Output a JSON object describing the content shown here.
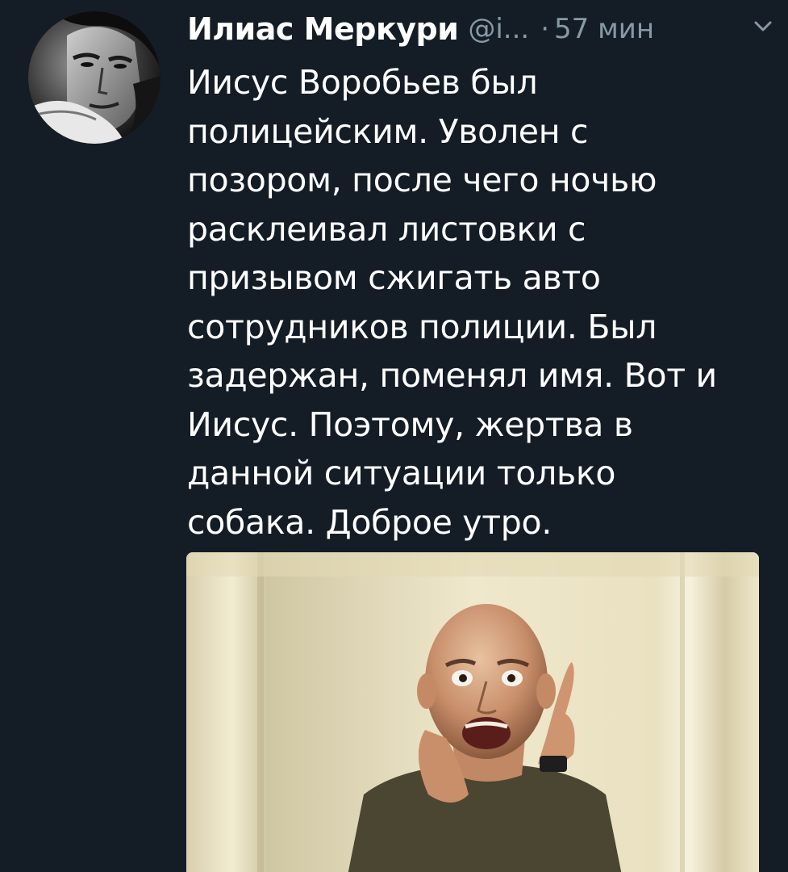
{
  "tweet": {
    "author_name": "Илиас Меркури",
    "handle": "@i...",
    "separator": "·",
    "timestamp": "57 мин",
    "body_lines": [
      "Иисус Воробьев был",
      "полицейским. Уволен с",
      "позором, после чего ночью",
      "расклеивал листовки с",
      "призывом сжигать авто",
      "сотрудников полиции. Был",
      "задержан, поменял имя. Вот и",
      "Иисус. Поэтому, жертва в",
      "данной ситуации только",
      "собака. Доброе утро."
    ]
  },
  "icons": {
    "menu": "chevron-down-icon"
  },
  "colors": {
    "background": "#141d26",
    "text_primary": "#ffffff",
    "text_secondary": "#8899a6"
  }
}
